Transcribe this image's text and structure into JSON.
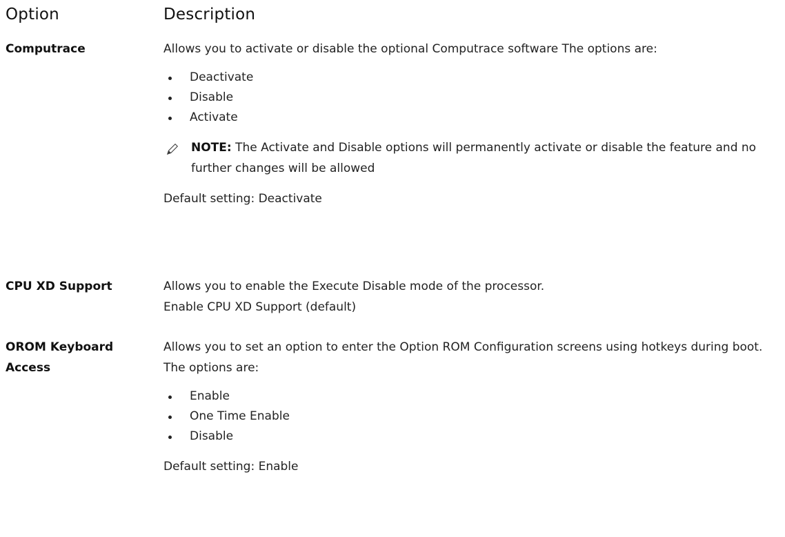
{
  "header": {
    "option": "Option",
    "description": "Description"
  },
  "rows": [
    {
      "name": "Computrace",
      "intro": "Allows you to activate or disable the optional Computrace software The options are:",
      "options": [
        "Deactivate",
        "Disable",
        "Activate"
      ],
      "note_label": "NOTE:",
      "note_text": "The Activate and Disable options will permanently activate or disable the feature and no further changes will be allowed",
      "default": "Default setting: Deactivate"
    },
    {
      "name": "CPU XD Support",
      "intro": "Allows you to enable the Execute Disable mode of the processor.",
      "detail": "Enable CPU XD Support (default)"
    },
    {
      "name": "OROM Keyboard Access",
      "intro": "Allows you to set an option to enter the Option ROM Configuration screens using hotkeys during boot. The options are:",
      "options": [
        "Enable",
        "One Time Enable",
        "Disable"
      ],
      "default": "Default setting: Enable"
    }
  ],
  "icons": {
    "note": "pencil-icon"
  }
}
